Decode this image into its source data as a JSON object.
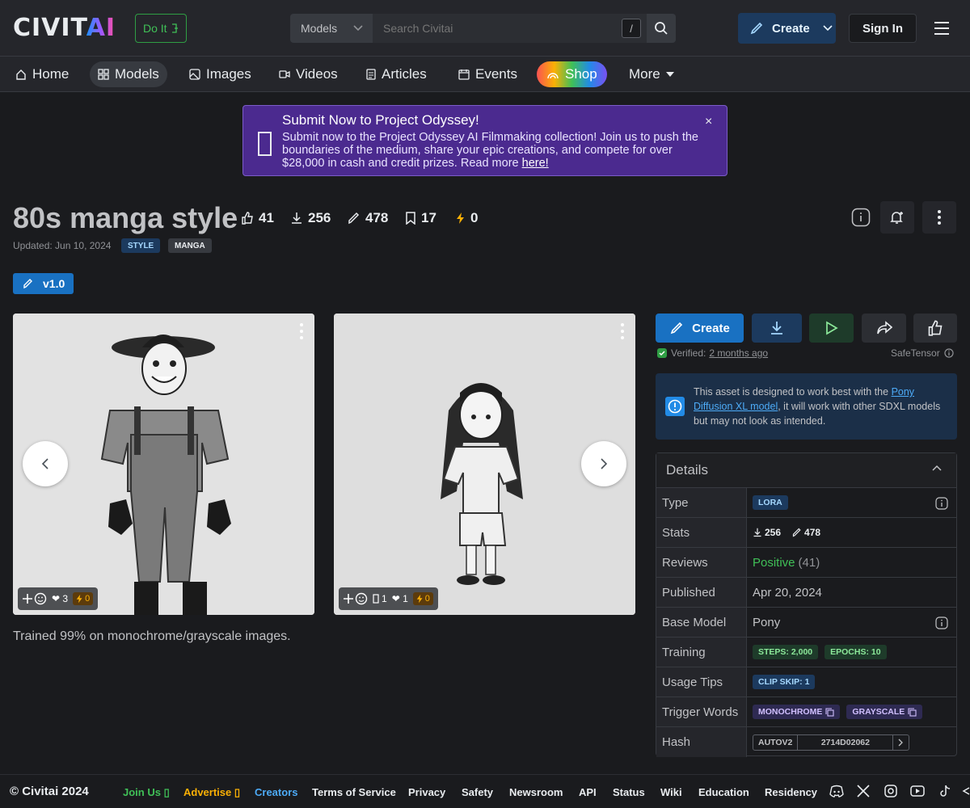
{
  "header": {
    "logo": {
      "main": "CIVIT",
      "accent": "AI"
    },
    "doit_label": "Do It",
    "search": {
      "category": "Models",
      "placeholder": "Search Civitai",
      "shortcut": "/"
    },
    "create_label": "Create",
    "signin_label": "Sign In"
  },
  "nav": {
    "items": [
      {
        "label": "Home"
      },
      {
        "label": "Models"
      },
      {
        "label": "Images"
      },
      {
        "label": "Videos"
      },
      {
        "label": "Articles"
      },
      {
        "label": "Events"
      },
      {
        "label": "Shop"
      },
      {
        "label": "More"
      }
    ]
  },
  "banner": {
    "title": "Submit Now to Project Odyssey!",
    "body": "Submit now to the Project Odyssey AI Filmmaking collection! Join us to push the boundaries of the medium, share your epic creations, and compete for over $28,000 in cash and credit prizes. Read more ",
    "link": "here!",
    "close": "×"
  },
  "model": {
    "title": "80s manga style",
    "stats": {
      "likes": "41",
      "downloads": "256",
      "generations": "478",
      "collected": "17",
      "buzz": "0"
    },
    "updated": "Updated: Jun 10, 2024",
    "tags": [
      "STYLE",
      "MANGA"
    ],
    "version": "v1.0",
    "description": "Trained 99% on monochrome/grayscale images."
  },
  "gallery": [
    {
      "reactions": "3",
      "buzz": "0"
    },
    {
      "comments": "1",
      "reactions": "1",
      "buzz": "0"
    }
  ],
  "actions": {
    "create_label": "Create",
    "verified_prefix": "Verified: ",
    "verified_time": "2 months ago",
    "safetensor": "SafeTensor"
  },
  "alert": {
    "text_before": "This asset is designed to work best with the ",
    "link": "Pony Diffusion XL model",
    "text_after": ", it will work with other SDXL models but may not look as intended."
  },
  "details": {
    "title": "Details",
    "rows": {
      "type": {
        "label": "Type",
        "value": "LORA"
      },
      "stats": {
        "label": "Stats",
        "downloads": "256",
        "generations": "478"
      },
      "reviews": {
        "label": "Reviews",
        "sentiment": "Positive",
        "count": "(41)"
      },
      "published": {
        "label": "Published",
        "value": "Apr 20, 2024"
      },
      "base_model": {
        "label": "Base Model",
        "value": "Pony"
      },
      "training": {
        "label": "Training",
        "steps": "STEPS: 2,000",
        "epochs": "EPOCHS: 10"
      },
      "usage": {
        "label": "Usage Tips",
        "clip": "CLIP SKIP: 1"
      },
      "trigger": {
        "label": "Trigger Words",
        "words": [
          "MONOCHROME",
          "GRAYSCALE"
        ]
      },
      "hash": {
        "label": "Hash",
        "algo": "AUTOV2",
        "value": "2714D02062"
      }
    }
  },
  "footer": {
    "copyright": "© Civitai 2024",
    "links": [
      "Join Us",
      "Advertise",
      "Creators",
      "Terms of Service",
      "Privacy",
      "Safety",
      "Newsroom",
      "API",
      "Status",
      "Wiki",
      "Education",
      "Residency"
    ]
  },
  "colors": {
    "accent": "#228be6",
    "positive": "#40c057",
    "joinus": "#40c057",
    "advertise": "#fab005",
    "creators": "#4dabf7"
  }
}
